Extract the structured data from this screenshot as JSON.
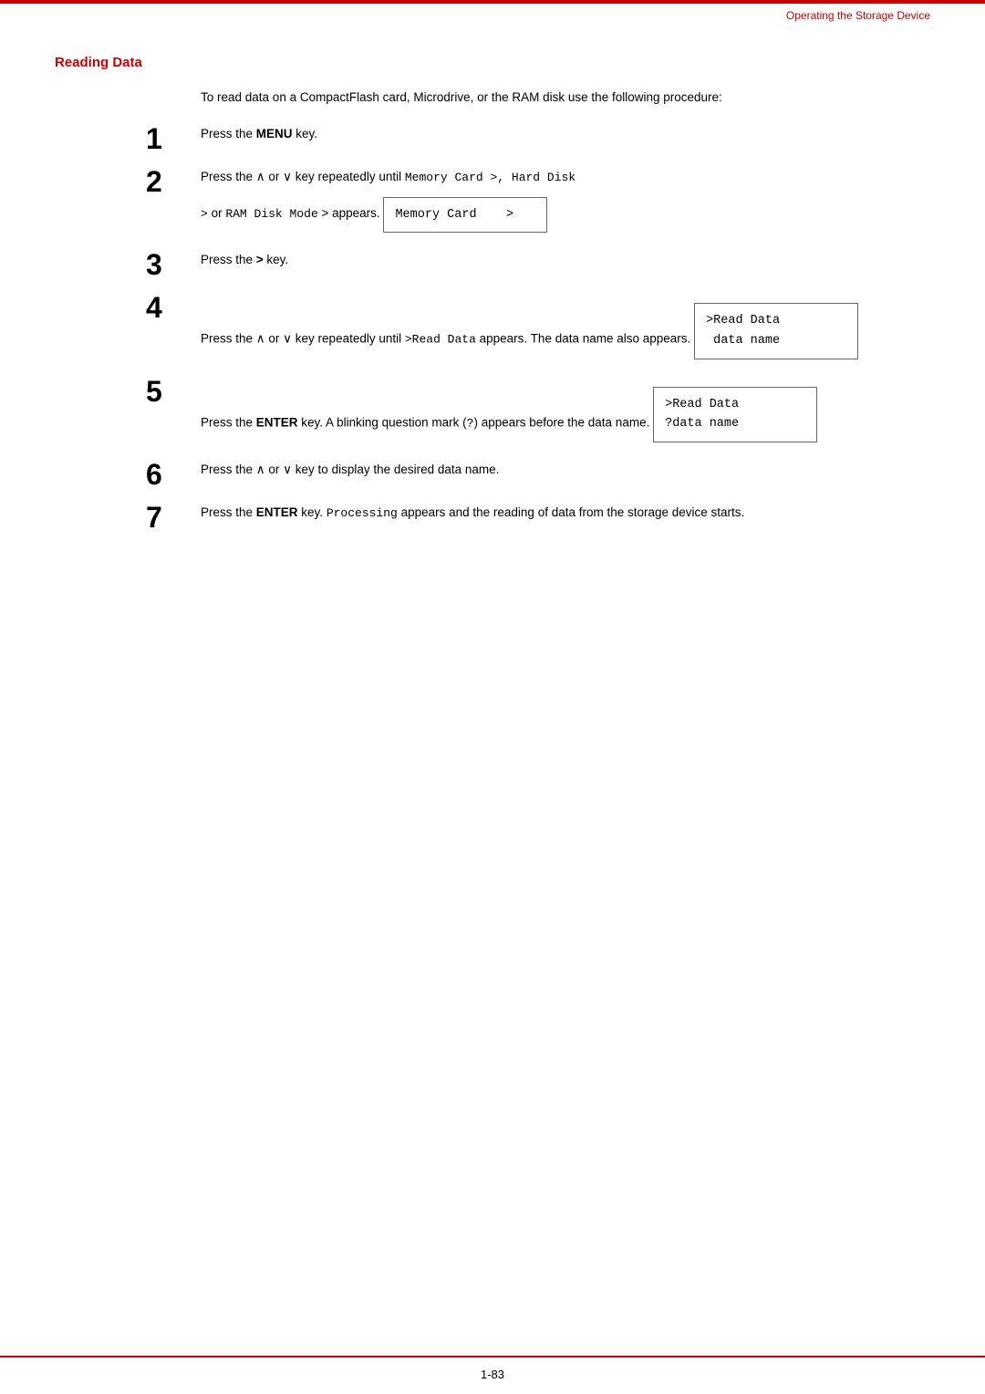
{
  "header": {
    "top_rule_color": "#cc0000",
    "breadcrumb": "Operating the Storage Device"
  },
  "section": {
    "title": "Reading Data"
  },
  "intro": {
    "text": "To read data on a CompactFlash card, Microdrive, or the RAM disk use the following procedure:"
  },
  "steps": [
    {
      "number": "1",
      "text_prefix": "Press the ",
      "text_bold": "MENU",
      "text_suffix": " key.",
      "has_box": false
    },
    {
      "number": "2",
      "text_prefix": "Press the ∧ or ∨ key repeatedly until ",
      "text_code": "Memory Card >, Hard Disk",
      "text_suffix_1": "",
      "text_line2_prefix": "> or ",
      "text_line2_code": "RAM Disk Mode",
      "text_line2_suffix": " > appears.",
      "has_box": true,
      "box_lines": [
        "Memory Card    >"
      ]
    },
    {
      "number": "3",
      "text_prefix": "Press the ",
      "text_bold": ">",
      "text_suffix": " key.",
      "has_box": false
    },
    {
      "number": "4",
      "text_prefix": "Press the ∧ or ∨ key repeatedly until ",
      "text_code": ">Read Data",
      "text_suffix": " appears. The data name also appears.",
      "has_box": true,
      "box_lines": [
        ">Read Data",
        " data name"
      ]
    },
    {
      "number": "5",
      "text_prefix": "Press the ",
      "text_bold": "ENTER",
      "text_suffix": " key. A blinking question mark (",
      "text_code2": "?",
      "text_suffix2": ") appears before the data name.",
      "has_box": true,
      "box_lines": [
        ">Read Data",
        "?data name"
      ]
    },
    {
      "number": "6",
      "text_prefix": "Press the ∧ or ∨ key to display the desired data name.",
      "has_box": false
    },
    {
      "number": "7",
      "text_prefix": "Press the ",
      "text_bold": "ENTER",
      "text_suffix": " key. ",
      "text_code": "Processing",
      "text_suffix2": " appears and the reading of data from the storage device starts.",
      "has_box": false
    }
  ],
  "footer": {
    "page_number": "1-83"
  }
}
